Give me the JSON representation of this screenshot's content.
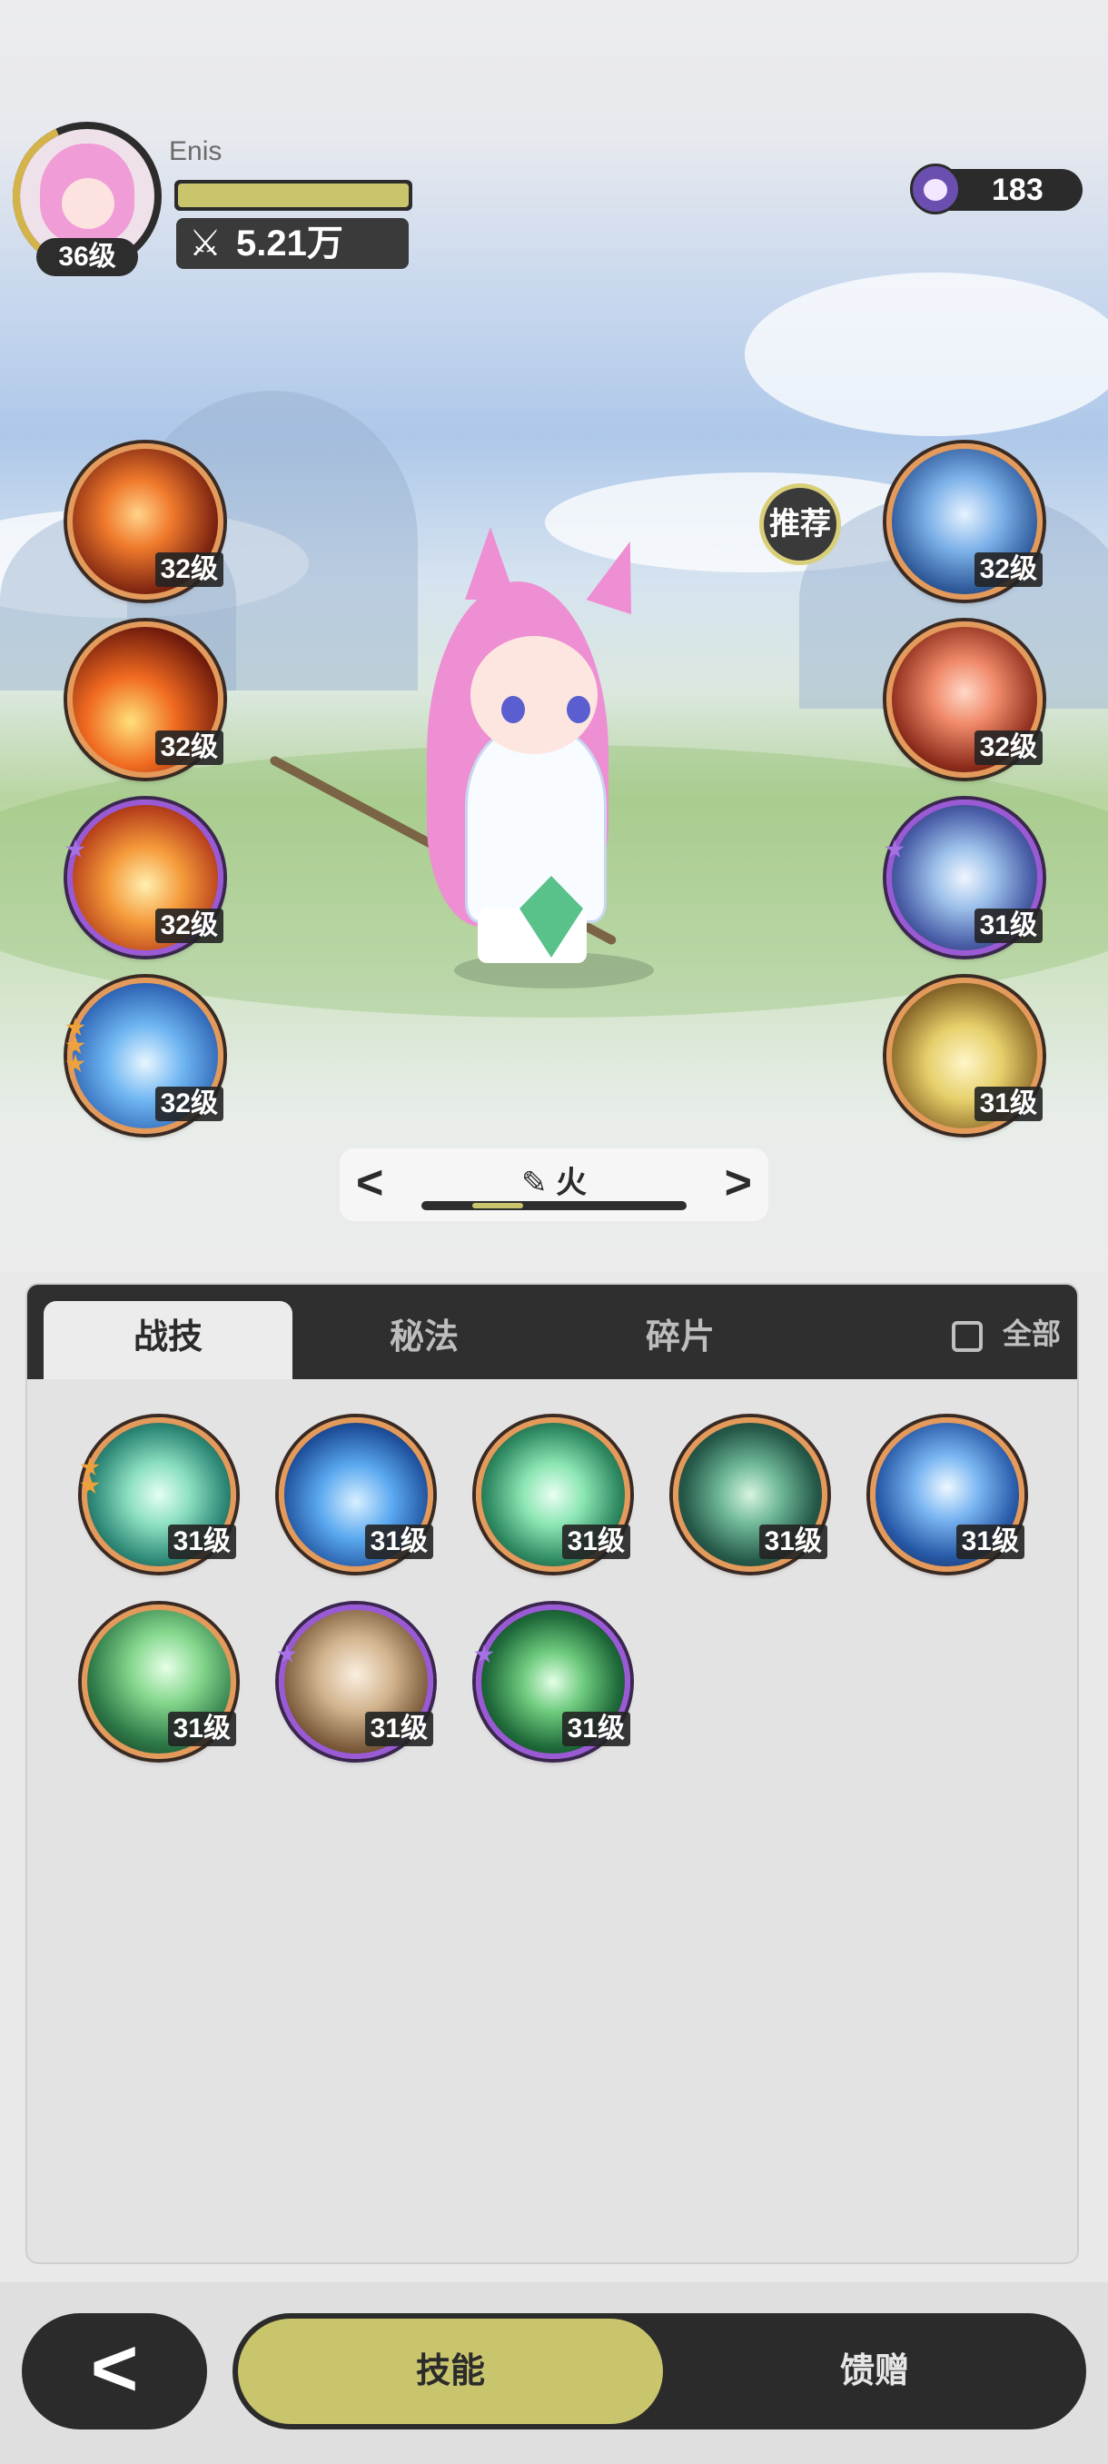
{
  "player": {
    "name": "Enis",
    "level": "36级",
    "power": "5.21万",
    "power_icon": "crossed-swords-icon"
  },
  "currency": {
    "value": "183",
    "icon": "character-token-icon"
  },
  "recommend_label": "推荐",
  "equipped_left": [
    {
      "icon": "fire-swirl-skill-icon",
      "level": "32级",
      "frame": "orange",
      "stars": 0
    },
    {
      "icon": "fire-burst-skill-icon",
      "level": "32级",
      "frame": "orange",
      "stars": 0
    },
    {
      "icon": "fire-orb-skill-icon",
      "level": "32级",
      "frame": "purple",
      "stars": 1
    },
    {
      "icon": "ice-shard-skill-icon",
      "level": "32级",
      "frame": "orange",
      "stars": 3
    }
  ],
  "equipped_right": [
    {
      "icon": "ice-crystal-skill-icon",
      "level": "32级",
      "frame": "orange",
      "stars": 0
    },
    {
      "icon": "flame-spirit-skill-icon",
      "level": "32级",
      "frame": "orange",
      "stars": 0
    },
    {
      "icon": "frost-star-skill-icon",
      "level": "31级",
      "frame": "purple",
      "stars": 1
    },
    {
      "icon": "golden-wing-skill-icon",
      "level": "31级",
      "frame": "orange",
      "stars": 0
    }
  ],
  "element_switcher": {
    "label": "火",
    "prev": "<",
    "next": ">"
  },
  "tabs": [
    {
      "label": "战技",
      "active": true
    },
    {
      "label": "秘法",
      "active": false
    },
    {
      "label": "碎片",
      "active": false
    }
  ],
  "all_toggle": {
    "label": "全部",
    "checked": false
  },
  "skills": [
    {
      "icon": "wind-vortex-skill-icon",
      "level": "31级",
      "frame": "orange",
      "stars": 2
    },
    {
      "icon": "water-wisp-skill-icon",
      "level": "31级",
      "frame": "orange",
      "stars": 0
    },
    {
      "icon": "wind-blade-skill-icon",
      "level": "31级",
      "frame": "orange",
      "stars": 0
    },
    {
      "icon": "thorn-vine-skill-icon",
      "level": "31级",
      "frame": "orange",
      "stars": 0
    },
    {
      "icon": "ice-spear-skill-icon",
      "level": "31级",
      "frame": "orange",
      "stars": 0
    },
    {
      "icon": "green-comet-skill-icon",
      "level": "31级",
      "frame": "orange",
      "stars": 0
    },
    {
      "icon": "rock-shield-skill-icon",
      "level": "31级",
      "frame": "purple",
      "stars": 1
    },
    {
      "icon": "heal-plus-skill-icon",
      "level": "31级",
      "frame": "purple",
      "stars": 1
    }
  ],
  "bottom_nav": {
    "back": "<",
    "skill": "技能",
    "gift": "馈赠"
  },
  "colors": {
    "accent": "#c9c56d",
    "dark": "#2b2b2b",
    "orange_frame": "#e49a5a",
    "purple_frame": "#9a5ad6"
  }
}
